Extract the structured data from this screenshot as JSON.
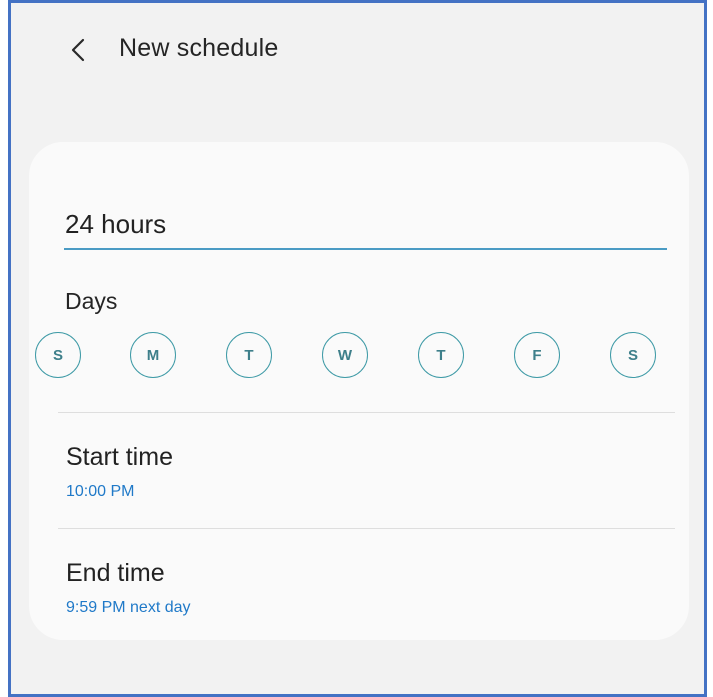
{
  "header": {
    "title": "New schedule",
    "back_icon": "chevron-left-icon"
  },
  "schedule": {
    "name_value": "24 hours",
    "days_label": "Days",
    "days": [
      "S",
      "M",
      "T",
      "W",
      "T",
      "F",
      "S"
    ],
    "start_time": {
      "label": "Start time",
      "value": "10:00 PM"
    },
    "end_time": {
      "label": "End time",
      "value": "9:59 PM next day"
    }
  },
  "colors": {
    "frame_border": "#4472c4",
    "accent": "#1f79c8",
    "day_circle": "#3e9aa6",
    "underline": "#4a9bc4"
  }
}
